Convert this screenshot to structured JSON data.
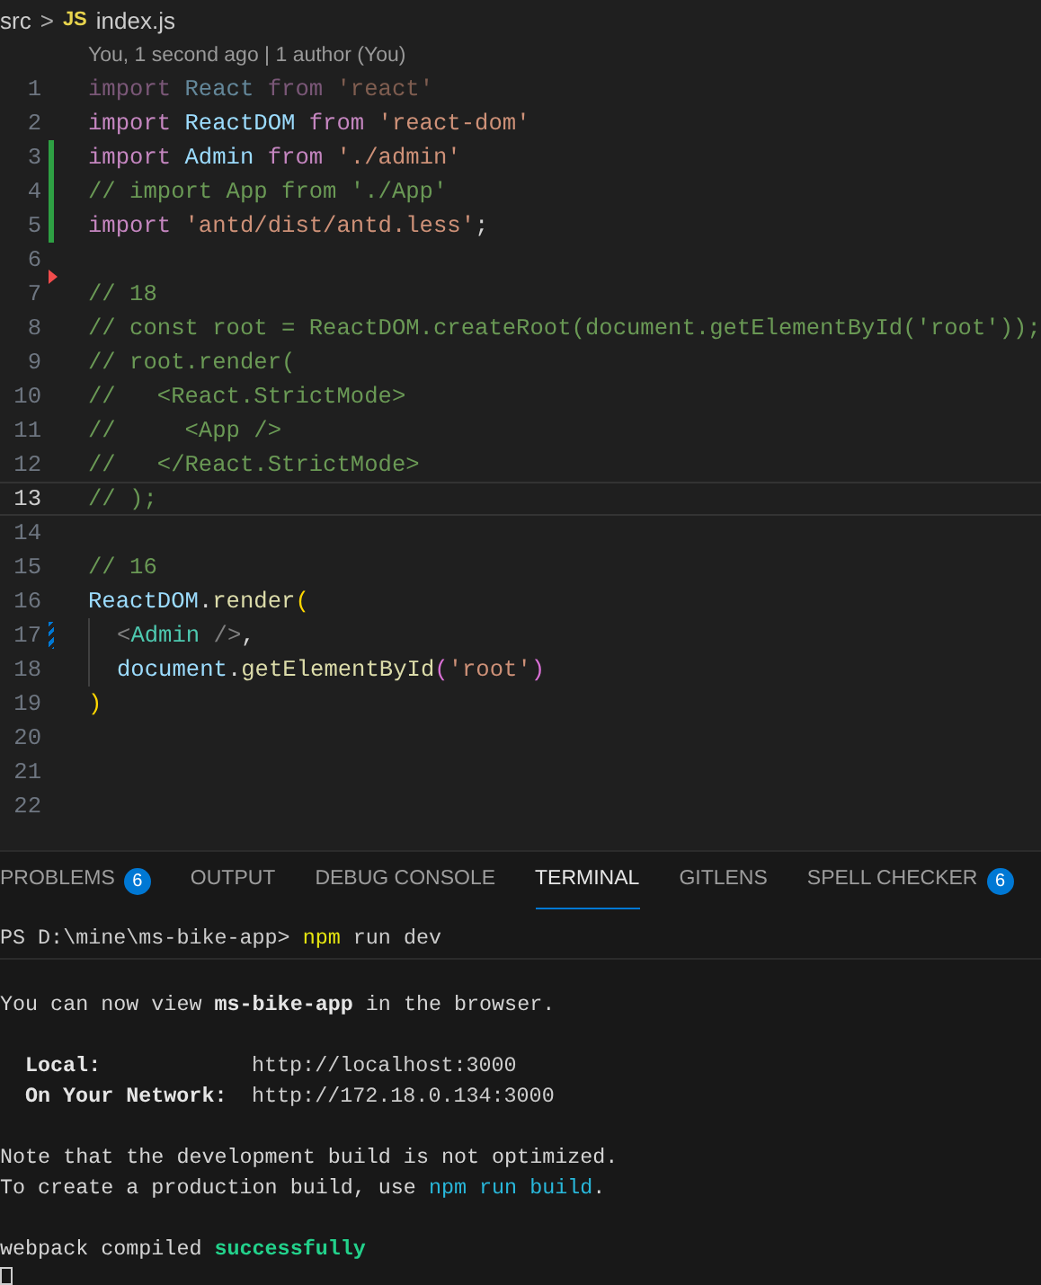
{
  "breadcrumb": {
    "folder": "src",
    "separator": ">",
    "file_badge": "JS",
    "file": "index.js"
  },
  "blame": "You, 1 second ago | 1 author (You)",
  "lines": [
    {
      "number": "1",
      "current": false,
      "dimmed": true,
      "guide": false,
      "kind": "plain",
      "tokens": [
        {
          "text": "import",
          "kind": "keyword"
        },
        {
          "text": " React ",
          "kind": "ident"
        },
        {
          "text": "from",
          "kind": "keyword"
        },
        {
          "text": " 'react'",
          "kind": "string"
        }
      ]
    },
    {
      "number": "2",
      "current": false,
      "dimmed": false,
      "guide": false,
      "kind": "plain",
      "tokens": [
        {
          "text": "import",
          "kind": "keyword"
        },
        {
          "text": " ReactDOM ",
          "kind": "ident"
        },
        {
          "text": "from",
          "kind": "keyword"
        },
        {
          "text": " 'react-dom'",
          "kind": "string"
        }
      ]
    },
    {
      "number": "3",
      "current": false,
      "dimmed": false,
      "guide": false,
      "kind": "added",
      "tokens": [
        {
          "text": "import",
          "kind": "keyword"
        },
        {
          "text": " Admin ",
          "kind": "ident"
        },
        {
          "text": "from",
          "kind": "keyword"
        },
        {
          "text": " './admin'",
          "kind": "string"
        }
      ]
    },
    {
      "number": "4",
      "current": false,
      "dimmed": false,
      "guide": false,
      "kind": "added",
      "tokens": [
        {
          "text": "// import App from './App'",
          "kind": "comment"
        }
      ]
    },
    {
      "number": "5",
      "current": false,
      "dimmed": false,
      "guide": false,
      "kind": "added",
      "tokens": [
        {
          "text": "import",
          "kind": "keyword"
        },
        {
          "text": " 'antd/dist/antd.less'",
          "kind": "string"
        },
        {
          "text": ";",
          "kind": "plain"
        }
      ]
    },
    {
      "number": "6",
      "current": false,
      "kind": "plain"
    },
    {
      "number": "7",
      "current": false,
      "dimmed": false,
      "guide": false,
      "kind": "deleted",
      "tokens": [
        {
          "text": "// 18",
          "kind": "comment"
        }
      ]
    },
    {
      "number": "8",
      "current": false,
      "dimmed": false,
      "guide": false,
      "kind": "plain",
      "tokens": [
        {
          "text": "// const root = ReactDOM.createRoot(document.getElementById('root'));",
          "kind": "comment"
        }
      ]
    },
    {
      "number": "9",
      "current": false,
      "dimmed": false,
      "guide": false,
      "kind": "plain",
      "tokens": [
        {
          "text": "// root.render(",
          "kind": "comment"
        }
      ]
    },
    {
      "number": "10",
      "current": false,
      "dimmed": false,
      "guide": false,
      "kind": "plain",
      "tokens": [
        {
          "text": "//   <React.StrictMode>",
          "kind": "comment"
        }
      ]
    },
    {
      "number": "11",
      "current": false,
      "dimmed": false,
      "guide": false,
      "kind": "plain",
      "tokens": [
        {
          "text": "//     <App />",
          "kind": "comment"
        }
      ]
    },
    {
      "number": "12",
      "current": false,
      "dimmed": false,
      "guide": false,
      "kind": "plain",
      "tokens": [
        {
          "text": "//   </React.StrictMode>",
          "kind": "comment"
        }
      ]
    },
    {
      "number": "13",
      "current": true,
      "dimmed": false,
      "guide": false,
      "kind": "plain",
      "tokens": [
        {
          "text": "// );",
          "kind": "comment"
        }
      ]
    },
    {
      "number": "14",
      "current": false,
      "kind": "plain"
    },
    {
      "number": "15",
      "current": false,
      "dimmed": false,
      "guide": false,
      "kind": "plain",
      "tokens": [
        {
          "text": "// 16",
          "kind": "comment"
        }
      ]
    },
    {
      "number": "16",
      "current": false,
      "dimmed": false,
      "guide": false,
      "kind": "plain",
      "tokens": [
        {
          "text": "ReactDOM",
          "kind": "ident"
        },
        {
          "text": ".",
          "kind": "plain"
        },
        {
          "text": "render",
          "kind": "func"
        },
        {
          "text": "(",
          "kind": "bracket"
        }
      ]
    },
    {
      "number": "17",
      "current": false,
      "dimmed": false,
      "guide": true,
      "kind": "modified",
      "tokens": [
        {
          "text": "<",
          "kind": "punct"
        },
        {
          "text": "Admin",
          "kind": "tag"
        },
        {
          "text": " />",
          "kind": "punct"
        },
        {
          "text": ",",
          "kind": "plain"
        }
      ]
    },
    {
      "number": "18",
      "current": false,
      "dimmed": false,
      "guide": true,
      "kind": "plain",
      "tokens": [
        {
          "text": "document",
          "kind": "ident"
        },
        {
          "text": ".",
          "kind": "plain"
        },
        {
          "text": "getElementById",
          "kind": "func"
        },
        {
          "text": "(",
          "kind": "bracket2"
        },
        {
          "text": "'root'",
          "kind": "string"
        },
        {
          "text": ")",
          "kind": "bracket2"
        }
      ]
    },
    {
      "number": "19",
      "current": false,
      "dimmed": false,
      "guide": false,
      "kind": "plain",
      "tokens": [
        {
          "text": ")",
          "kind": "bracket"
        }
      ]
    },
    {
      "number": "20",
      "current": false,
      "kind": "plain"
    },
    {
      "number": "21",
      "current": false,
      "kind": "plain"
    },
    {
      "number": "22",
      "current": false,
      "kind": "plain"
    }
  ],
  "panel_tabs": [
    {
      "label": "PROBLEMS",
      "badge": "6",
      "selected": false
    },
    {
      "label": "OUTPUT",
      "selected": false
    },
    {
      "label": "DEBUG CONSOLE",
      "selected": false
    },
    {
      "label": "TERMINAL",
      "selected": true
    },
    {
      "label": "GITLENS",
      "selected": false
    },
    {
      "label": "SPELL CHECKER",
      "badge": "6",
      "selected": false
    }
  ],
  "terminal": {
    "prompt": "PS D:\\mine\\ms-bike-app>",
    "command": "npm",
    "args": "run dev",
    "blocks": [
      [
        {
          "tokens": [
            {
              "text": "You can now view ",
              "kind": "plain"
            },
            {
              "text": "ms-bike-app",
              "kind": "bold"
            },
            {
              "text": " in the browser.",
              "kind": "plain"
            }
          ]
        }
      ],
      [
        {
          "label": "Local:",
          "value": "http://localhost:3000"
        },
        {
          "label": "On Your Network:",
          "value": "http://172.18.0.134:3000"
        }
      ],
      [
        {
          "tokens": [
            {
              "text": "Note that the development build is not optimized.",
              "kind": "plain"
            }
          ]
        },
        {
          "tokens": [
            {
              "text": "To create a production build, use ",
              "kind": "plain"
            },
            {
              "text": "npm run build",
              "kind": "link"
            },
            {
              "text": ".",
              "kind": "plain"
            }
          ]
        }
      ],
      [
        {
          "tokens": [
            {
              "text": "webpack compiled ",
              "kind": "plain"
            },
            {
              "text": "successfully",
              "kind": "success"
            }
          ]
        }
      ]
    ]
  }
}
